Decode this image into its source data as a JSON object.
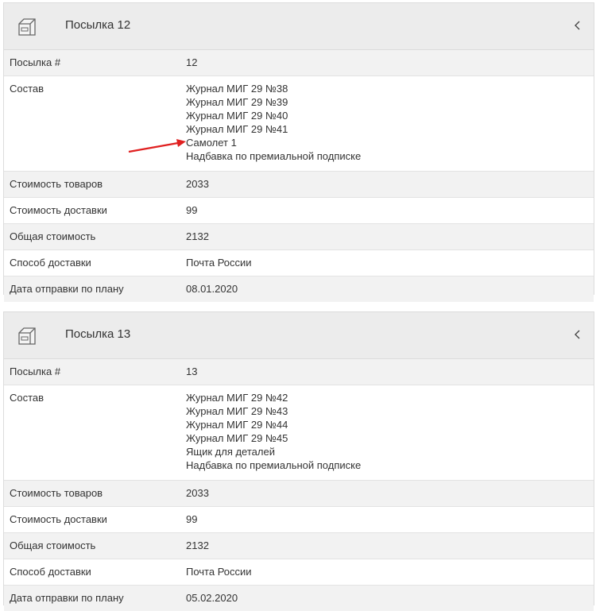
{
  "parcels": [
    {
      "title": "Посылка 12",
      "rows": {
        "number_label": "Посылка #",
        "number_value": "12",
        "contents_label": "Состав",
        "contents": [
          "Журнал МИГ 29 №38",
          "Журнал МИГ 29 №39",
          "Журнал МИГ 29 №40",
          "Журнал МИГ 29 №41",
          "Самолет 1",
          "Надбавка по премиальной подписке"
        ],
        "goods_cost_label": "Стоимость товаров",
        "goods_cost_value": "2033",
        "delivery_cost_label": "Стоимость доставки",
        "delivery_cost_value": "99",
        "total_label": "Общая стоимость",
        "total_value": "2132",
        "method_label": "Способ доставки",
        "method_value": "Почта России",
        "date_label": "Дата отправки по плану",
        "date_value": "08.01.2020"
      }
    },
    {
      "title": "Посылка 13",
      "rows": {
        "number_label": "Посылка #",
        "number_value": "13",
        "contents_label": "Состав",
        "contents": [
          "Журнал МИГ 29 №42",
          "Журнал МИГ 29 №43",
          "Журнал МИГ 29 №44",
          "Журнал МИГ 29 №45",
          "Ящик для деталей",
          "Надбавка по премиальной подписке"
        ],
        "goods_cost_label": "Стоимость товаров",
        "goods_cost_value": "2033",
        "delivery_cost_label": "Стоимость доставки",
        "delivery_cost_value": "99",
        "total_label": "Общая стоимость",
        "total_value": "2132",
        "method_label": "Способ доставки",
        "method_value": "Почта России",
        "date_label": "Дата отправки по плану",
        "date_value": "05.02.2020"
      }
    }
  ],
  "colors": {
    "annotation_arrow": "#e02020",
    "header_bg": "#ececec",
    "row_shade": "#f2f2f2"
  },
  "icons": {
    "header": "package-box-icon",
    "collapse": "chevron-left-icon",
    "annotation": "red-arrow-icon"
  }
}
